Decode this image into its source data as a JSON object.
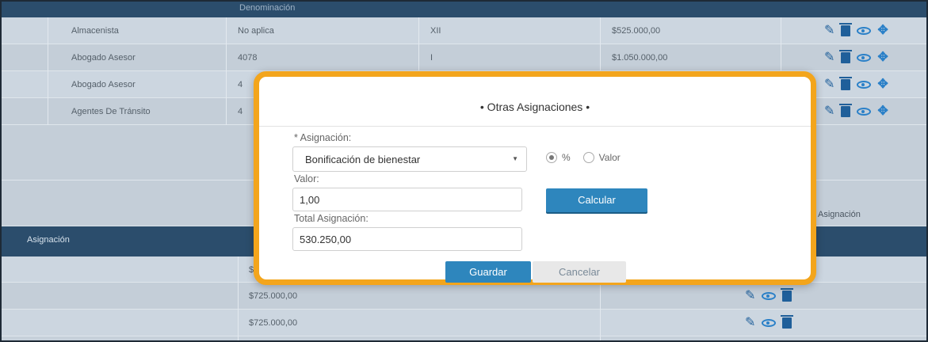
{
  "table_top": {
    "header_partial": "Denominación",
    "rows": [
      {
        "cargo": "Almacenista",
        "codigo": "No aplica",
        "grado": "XII",
        "salario": "$525.000,00"
      },
      {
        "cargo": "Abogado Asesor",
        "codigo": "4078",
        "grado": "I",
        "salario": "$1.050.000,00"
      },
      {
        "cargo": "Abogado Asesor",
        "codigo": "4",
        "grado": "",
        "salario": ""
      },
      {
        "cargo": "Agentes De Tránsito",
        "codigo": "4",
        "grado": "",
        "salario": ""
      }
    ]
  },
  "section_bottom": {
    "header_label": "Asignación",
    "right_label": "Asignación",
    "rows": [
      {
        "valor": "$"
      },
      {
        "valor": "$725.000,00"
      },
      {
        "valor": "$725.000,00"
      }
    ]
  },
  "icons": {
    "edit": "pencil-icon",
    "delete": "trash-icon",
    "view": "eye-icon",
    "move": "move-icon",
    "pencil_glyph": "✎",
    "move_glyph": "✥"
  },
  "modal": {
    "title": "• Otras Asignaciones •",
    "asignacion_label": "* Asignación:",
    "asignacion_value": "Bonificación de bienestar",
    "caret": "▼",
    "radio_percent": "%",
    "radio_valor": "Valor",
    "radio_selected": "%",
    "valor_label": "Valor:",
    "valor_value": "1,00",
    "calcular_label": "Calcular",
    "total_label": "Total Asignación:",
    "total_value": "530.250,00",
    "guardar_label": "Guardar",
    "cancelar_label": "Cancelar"
  },
  "colors": {
    "header_bg": "#2b4d6c",
    "accent_blue": "#2e86bd",
    "modal_border": "#f3a51c"
  }
}
